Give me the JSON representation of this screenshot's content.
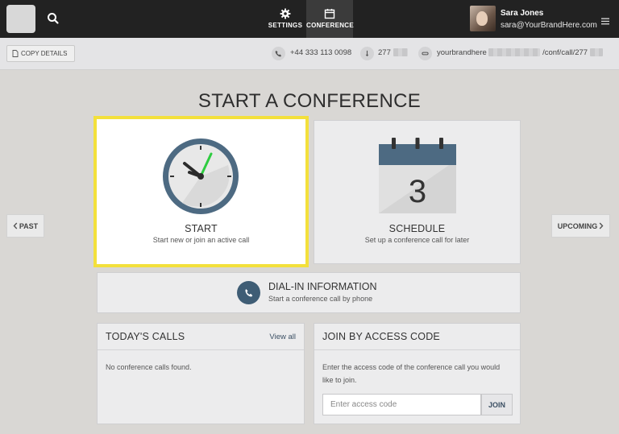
{
  "header": {
    "nav": [
      {
        "label": "SETTINGS",
        "icon": "gear-icon"
      },
      {
        "label": "CONFERENCE",
        "icon": "calendar-icon",
        "active": true
      }
    ],
    "user": {
      "name": "Sara Jones",
      "email": "sara@YourBrandHere.com"
    }
  },
  "infobar": {
    "copy_label": "COPY DETAILS",
    "phone": "+44 333 113 0098",
    "pin": "277",
    "url_prefix": "yourbrandhere",
    "url_suffix": "/conf/call/277"
  },
  "page": {
    "title": "START A CONFERENCE",
    "past_label": "PAST",
    "upcoming_label": "UPCOMING"
  },
  "start_card": {
    "title": "START",
    "subtitle": "Start new or join an active call"
  },
  "schedule_card": {
    "title": "SCHEDULE",
    "subtitle": "Set up a conference call for later",
    "calendar_day": "3"
  },
  "dial_card": {
    "title": "DIAL-IN INFORMATION",
    "subtitle": "Start a conference call by phone"
  },
  "calls_panel": {
    "title": "TODAY'S CALLS",
    "view_all": "View all",
    "empty": "No conference calls found."
  },
  "join_panel": {
    "title": "JOIN BY ACCESS CODE",
    "text": "Enter the access code of the conference call you would like to join.",
    "placeholder": "Enter access code",
    "button": "JOIN"
  },
  "colors": {
    "accent": "#3f5d75",
    "highlight": "#f3e03b",
    "clock_hand": "#2ecc40",
    "topbar": "#222222"
  }
}
